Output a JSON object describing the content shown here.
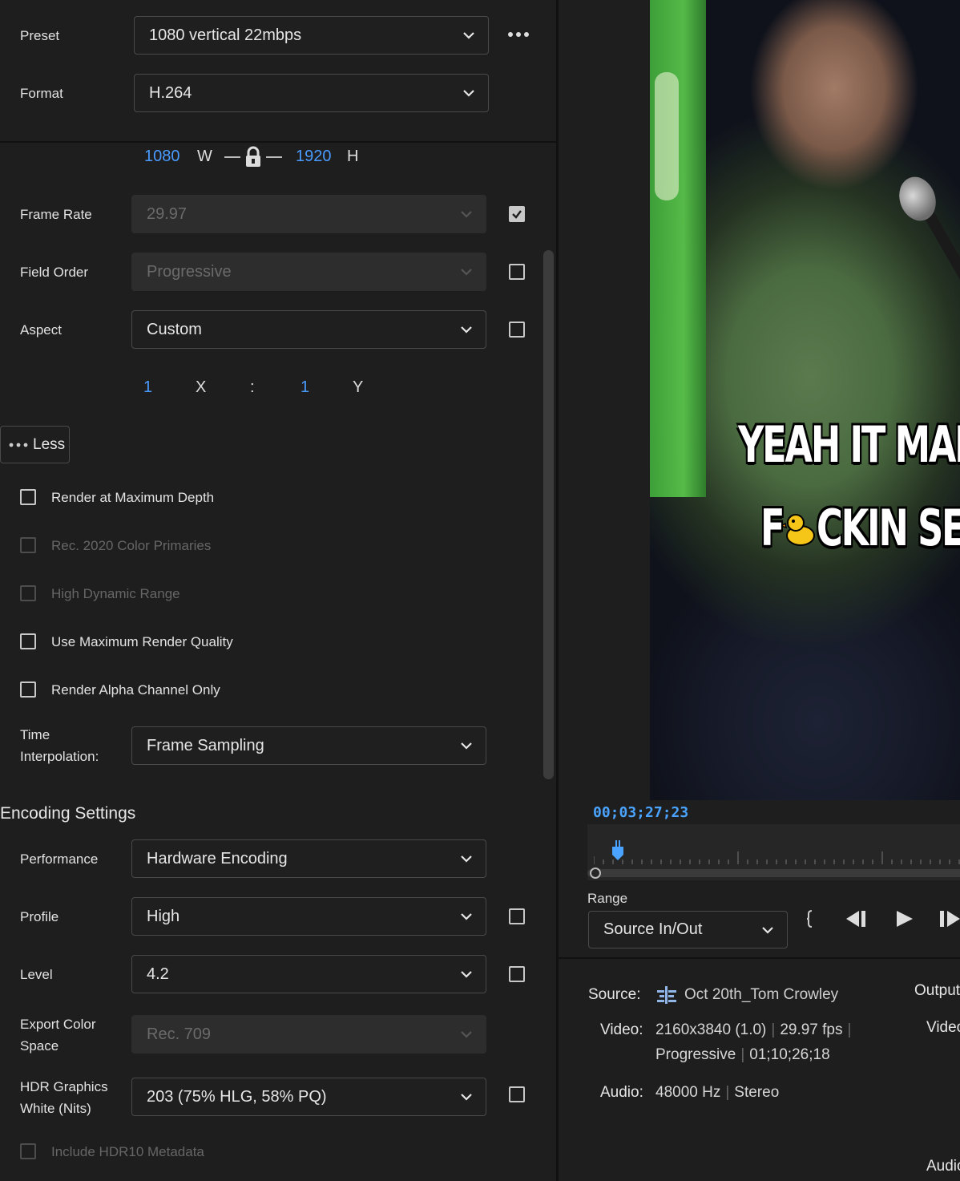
{
  "left": {
    "preset": {
      "label": "Preset",
      "value": "1080 vertical 22mbps"
    },
    "format": {
      "label": "Format",
      "value": "H.264"
    },
    "size": {
      "width": "1080",
      "width_unit": "W",
      "height": "1920",
      "height_unit": "H"
    },
    "frame_rate": {
      "label": "Frame Rate",
      "value": "29.97"
    },
    "field_order": {
      "label": "Field Order",
      "value": "Progressive"
    },
    "aspect": {
      "label": "Aspect",
      "value": "Custom",
      "x_val": "1",
      "x_label": "X",
      "sep": ":",
      "y_val": "1",
      "y_label": "Y"
    },
    "less_button": "Less",
    "options": [
      {
        "label": "Render at Maximum Depth",
        "enabled": true
      },
      {
        "label": "Rec. 2020 Color Primaries",
        "enabled": false
      },
      {
        "label": "High Dynamic Range",
        "enabled": false
      },
      {
        "label": "Use Maximum Render Quality",
        "enabled": true
      },
      {
        "label": "Render Alpha Channel Only",
        "enabled": true
      }
    ],
    "time_interp": {
      "label_line1": "Time",
      "label_line2": "Interpolation:",
      "value": "Frame Sampling"
    },
    "encoding_header": "Encoding Settings",
    "performance": {
      "label": "Performance",
      "value": "Hardware Encoding"
    },
    "profile": {
      "label": "Profile",
      "value": "High"
    },
    "level": {
      "label": "Level",
      "value": "4.2"
    },
    "export_color": {
      "label_line1": "Export Color",
      "label_line2": "Space",
      "value": "Rec. 709"
    },
    "hdr_white": {
      "label_line1": "HDR Graphics",
      "label_line2": "White (Nits)",
      "value": "203 (75% HLG, 58% PQ)"
    },
    "hdr10": {
      "label": "Include HDR10 Metadata"
    }
  },
  "right": {
    "caption_line1": "YEAH IT MAD",
    "caption_line2_a": "F",
    "caption_line2_b": "CKIN SE",
    "timecode": "00;03;27;23",
    "range_label": "Range",
    "range_value": "Source In/Out",
    "source_label": "Source:",
    "source_name": "Oct 20th_Tom Crowley",
    "output_label": "Output",
    "video_label": "Video:",
    "video_res": "2160x3840 (1.0)",
    "video_fps": "29.97 fps",
    "video_scan": "Progressive",
    "video_duration": "01;10;26;18",
    "audio_label": "Audio:",
    "audio_rate": "48000 Hz",
    "audio_channels": "Stereo",
    "output_video_label": "Video",
    "output_audio_label": "Audio"
  },
  "colors": {
    "accent": "#4a9bff",
    "panel": "#1e1e1e",
    "field": "#1f1f1f",
    "disabled_field": "#2d2d2d"
  },
  "icons": [
    "chevron-down-icon",
    "more-options-icon",
    "lock-icon",
    "check-icon",
    "mark-in-icon",
    "step-back-icon",
    "play-icon",
    "step-forward-icon",
    "sequence-icon"
  ]
}
